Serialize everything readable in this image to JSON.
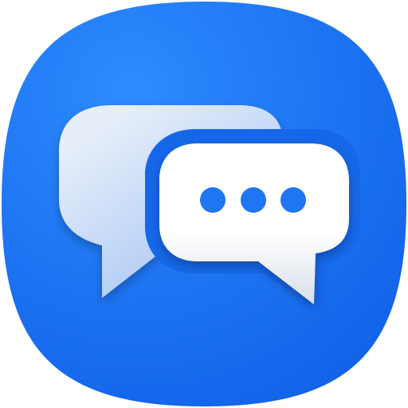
{
  "icon": {
    "name": "chat-bubbles-icon",
    "colors": {
      "background_light": "#2D8BFF",
      "background_dark": "#0F5FE6",
      "back_bubble_light": "#E6EEFA",
      "back_bubble_dark": "#9CBEF3",
      "front_bubble": "#FFFFFF",
      "front_bubble_shade": "#D8DEE8",
      "dots": "#1F76F3"
    }
  }
}
